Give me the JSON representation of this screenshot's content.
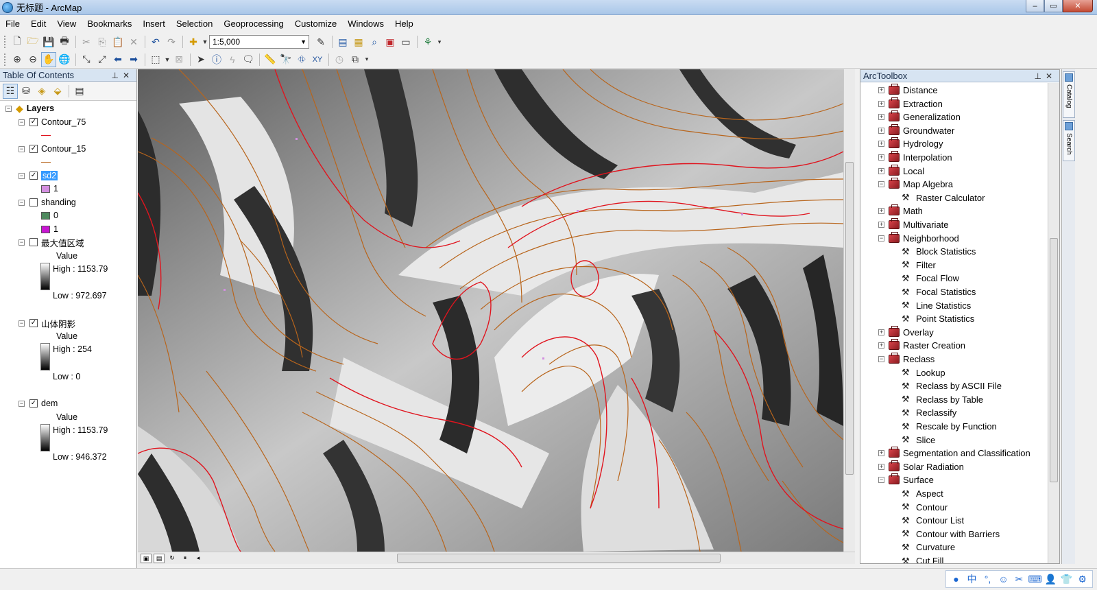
{
  "window": {
    "title": "无标题 - ArcMap",
    "controls": [
      "–",
      "▭",
      "✕"
    ]
  },
  "menu": [
    "File",
    "Edit",
    "View",
    "Bookmarks",
    "Insert",
    "Selection",
    "Geoprocessing",
    "Customize",
    "Windows",
    "Help"
  ],
  "toolbar": {
    "scale": "1:5,000"
  },
  "toc": {
    "title": "Table Of Contents",
    "root": "Layers",
    "layers": {
      "contour75": {
        "name": "Contour_75",
        "color": "#e0141e"
      },
      "contour15": {
        "name": "Contour_15",
        "color": "#b8651c"
      },
      "sd2": {
        "name": "sd2",
        "class_label": "1",
        "class_color": "#d38fe0"
      },
      "shanding": {
        "name": "shanding",
        "c0_label": "0",
        "c0_color": "#4e8a5e",
        "c1_label": "1",
        "c1_color": "#c816d2"
      },
      "maxregion": {
        "name": "最大值区域",
        "field": "Value",
        "high": "High : 1153.79",
        "low": "Low : 972.697"
      },
      "hillshade": {
        "name": "山体阴影",
        "field": "Value",
        "high": "High : 254",
        "low": "Low : 0"
      },
      "dem": {
        "name": "dem",
        "field": "Value",
        "high": "High : 1153.79",
        "low": "Low : 946.372"
      }
    }
  },
  "arctoolbox": {
    "title": "ArcToolbox",
    "items": [
      {
        "label": "Distance",
        "kind": "toolset",
        "state": "collapsed"
      },
      {
        "label": "Extraction",
        "kind": "toolset",
        "state": "collapsed"
      },
      {
        "label": "Generalization",
        "kind": "toolset",
        "state": "collapsed"
      },
      {
        "label": "Groundwater",
        "kind": "toolset",
        "state": "collapsed"
      },
      {
        "label": "Hydrology",
        "kind": "toolset",
        "state": "collapsed"
      },
      {
        "label": "Interpolation",
        "kind": "toolset",
        "state": "collapsed"
      },
      {
        "label": "Local",
        "kind": "toolset",
        "state": "collapsed"
      },
      {
        "label": "Map Algebra",
        "kind": "toolset",
        "state": "expanded"
      },
      {
        "label": "Raster Calculator",
        "kind": "tool"
      },
      {
        "label": "Math",
        "kind": "toolset",
        "state": "collapsed"
      },
      {
        "label": "Multivariate",
        "kind": "toolset",
        "state": "collapsed"
      },
      {
        "label": "Neighborhood",
        "kind": "toolset",
        "state": "expanded"
      },
      {
        "label": "Block Statistics",
        "kind": "tool"
      },
      {
        "label": "Filter",
        "kind": "tool"
      },
      {
        "label": "Focal Flow",
        "kind": "tool"
      },
      {
        "label": "Focal Statistics",
        "kind": "tool"
      },
      {
        "label": "Line Statistics",
        "kind": "tool"
      },
      {
        "label": "Point Statistics",
        "kind": "tool"
      },
      {
        "label": "Overlay",
        "kind": "toolset",
        "state": "collapsed"
      },
      {
        "label": "Raster Creation",
        "kind": "toolset",
        "state": "collapsed"
      },
      {
        "label": "Reclass",
        "kind": "toolset",
        "state": "expanded"
      },
      {
        "label": "Lookup",
        "kind": "tool"
      },
      {
        "label": "Reclass by ASCII File",
        "kind": "tool"
      },
      {
        "label": "Reclass by Table",
        "kind": "tool"
      },
      {
        "label": "Reclassify",
        "kind": "tool"
      },
      {
        "label": "Rescale by Function",
        "kind": "tool"
      },
      {
        "label": "Slice",
        "kind": "tool"
      },
      {
        "label": "Segmentation and Classification",
        "kind": "toolset",
        "state": "collapsed"
      },
      {
        "label": "Solar Radiation",
        "kind": "toolset",
        "state": "collapsed"
      },
      {
        "label": "Surface",
        "kind": "toolset",
        "state": "expanded"
      },
      {
        "label": "Aspect",
        "kind": "tool"
      },
      {
        "label": "Contour",
        "kind": "tool"
      },
      {
        "label": "Contour List",
        "kind": "tool"
      },
      {
        "label": "Contour with Barriers",
        "kind": "tool"
      },
      {
        "label": "Curvature",
        "kind": "tool"
      },
      {
        "label": "Cut Fill",
        "kind": "tool"
      }
    ]
  },
  "side_tabs": {
    "catalog": "Catalog",
    "search": "Search"
  },
  "ime": [
    "中",
    "°,",
    "☺",
    "✂",
    "⌨",
    "👤",
    "👕",
    "⚙"
  ]
}
